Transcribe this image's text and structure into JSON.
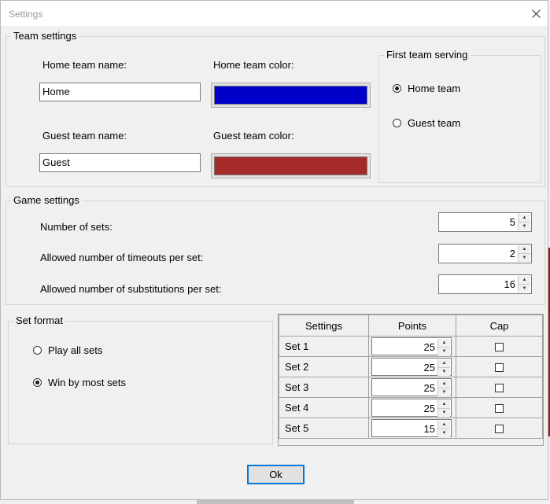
{
  "window": {
    "title": "Settings"
  },
  "team_settings": {
    "legend": "Team settings",
    "home_name_label": "Home team name:",
    "home_name_value": "Home",
    "home_color_label": "Home team color:",
    "home_color": "#0000c8",
    "guest_name_label": "Guest team name:",
    "guest_name_value": "Guest",
    "guest_color_label": "Guest team color:",
    "guest_color": "#a52a2a",
    "first_serving": {
      "legend": "First team serving",
      "options": [
        "Home team",
        "Guest team"
      ],
      "selected": "Home team"
    }
  },
  "game_settings": {
    "legend": "Game settings",
    "sets_label": "Number of sets:",
    "sets_value": "5",
    "timeouts_label": "Allowed number of timeouts per set:",
    "timeouts_value": "2",
    "subs_label": "Allowed number of substitutions per set:",
    "subs_value": "16"
  },
  "set_format": {
    "legend": "Set format",
    "options": [
      "Play all sets",
      "Win by most sets"
    ],
    "selected": "Win by most sets"
  },
  "sets_table": {
    "columns": [
      "Settings",
      "Points",
      "Cap"
    ],
    "rows": [
      {
        "name": "Set 1",
        "points": "25",
        "cap": false
      },
      {
        "name": "Set 2",
        "points": "25",
        "cap": false
      },
      {
        "name": "Set 3",
        "points": "25",
        "cap": false
      },
      {
        "name": "Set 4",
        "points": "25",
        "cap": false
      },
      {
        "name": "Set 5",
        "points": "15",
        "cap": false
      }
    ]
  },
  "ok_label": "Ok"
}
